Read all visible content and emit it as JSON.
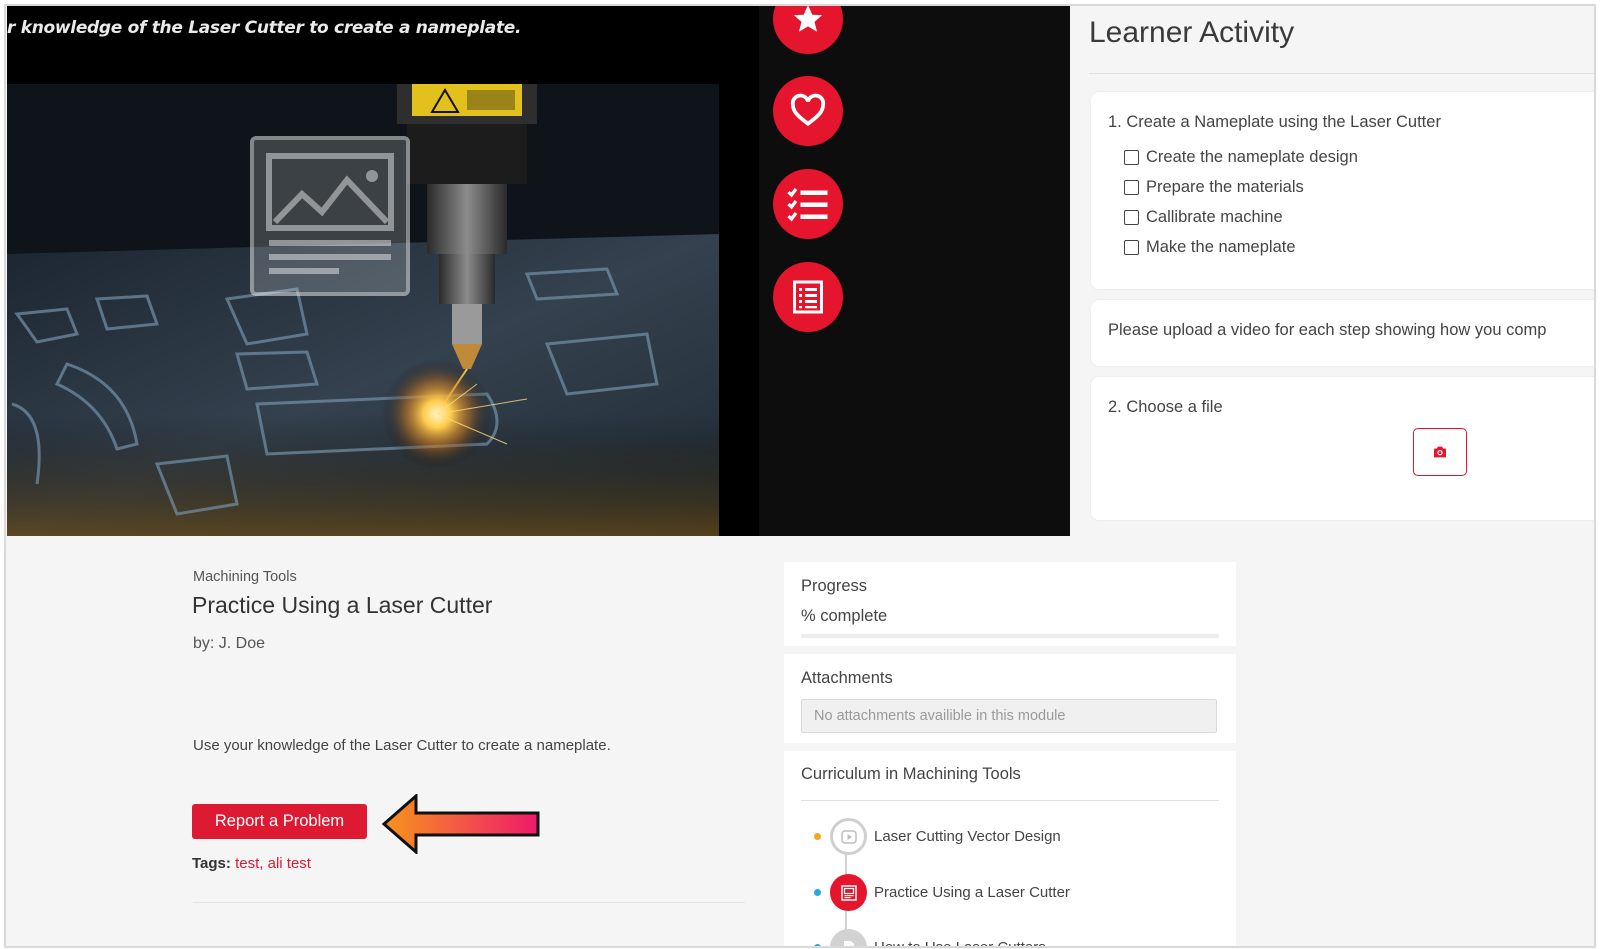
{
  "hero": {
    "caption": "r knowledge of the Laser Cutter to create a nameplate.",
    "actions": [
      {
        "name": "star-icon"
      },
      {
        "name": "heart-icon"
      },
      {
        "name": "checklist-icon"
      },
      {
        "name": "document-list-icon"
      }
    ]
  },
  "activity": {
    "title": "Learner Activity",
    "task1": {
      "heading": "1. Create a Nameplate using the Laser Cutter",
      "steps": [
        {
          "label": "Create the nameplate design",
          "checked": false
        },
        {
          "label": "Prepare the materials",
          "checked": false
        },
        {
          "label": "Callibrate machine",
          "checked": false
        },
        {
          "label": "Make the nameplate",
          "checked": false
        }
      ]
    },
    "instruction": "Please upload a video for each step showing how you comp",
    "task2": {
      "heading": "2. Choose a file",
      "upload_icon": "camera-icon"
    }
  },
  "module": {
    "category": "Machining Tools",
    "title": "Practice Using a Laser Cutter",
    "author": "by: J. Doe",
    "description": "Use your knowledge of the Laser Cutter to create a nameplate.",
    "report_button": "Report a Problem",
    "tags_label": "Tags:",
    "tags": [
      "test",
      "ali test"
    ],
    "tags_separator": ", "
  },
  "sidebar": {
    "progress_label": "Progress",
    "progress_text": "% complete",
    "attachments_label": "Attachments",
    "attachments_empty": "No attachments availible in this module",
    "curriculum_label": "Curriculum in Machining Tools",
    "curriculum": [
      {
        "label": "Laser Cutting Vector Design",
        "dot_color": "#f5a623",
        "icon": "video-icon",
        "active": false
      },
      {
        "label": "Practice Using a Laser Cutter",
        "dot_color": "#29a8e0",
        "icon": "activity-icon",
        "active": true
      },
      {
        "label": "How to Use Laser Cutters",
        "dot_color": "#29a8e0",
        "icon": "document-icon",
        "active": false
      }
    ]
  },
  "colors": {
    "accent": "#e4152d",
    "arrow_start": "#f7941d",
    "arrow_end": "#ee1a6b"
  }
}
